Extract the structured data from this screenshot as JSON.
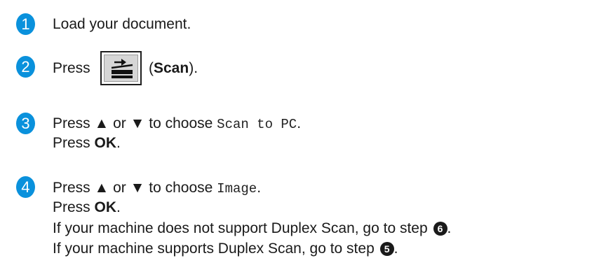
{
  "steps": [
    {
      "number": "1",
      "lines": [
        {
          "text": "Load your document."
        }
      ]
    },
    {
      "number": "2",
      "press": "Press",
      "open_paren": "(",
      "key_name": "Scan",
      "close_paren": ")."
    },
    {
      "number": "3",
      "choose_prefix": "Press ▲ or ▼ to choose",
      "option": "Scan to PC",
      "period": ".",
      "ok_prefix": "Press",
      "ok_key": "OK",
      "ok_suffix": "."
    },
    {
      "number": "4",
      "choose_prefix": "Press ▲ or ▼ to choose",
      "option": "Image",
      "period": ".",
      "ok_prefix": "Press",
      "ok_key": "OK",
      "ok_suffix": ".",
      "no_duplex_text": "If your machine does not support Duplex Scan, go to step",
      "no_duplex_step": "6",
      "duplex_text": "If your machine supports Duplex Scan, go to step",
      "duplex_step": "5",
      "end": "."
    }
  ],
  "icons": {
    "scan_key": "scan-key-icon"
  },
  "colors": {
    "step_badge": "#0a91dc",
    "text": "#1a1a1a"
  }
}
